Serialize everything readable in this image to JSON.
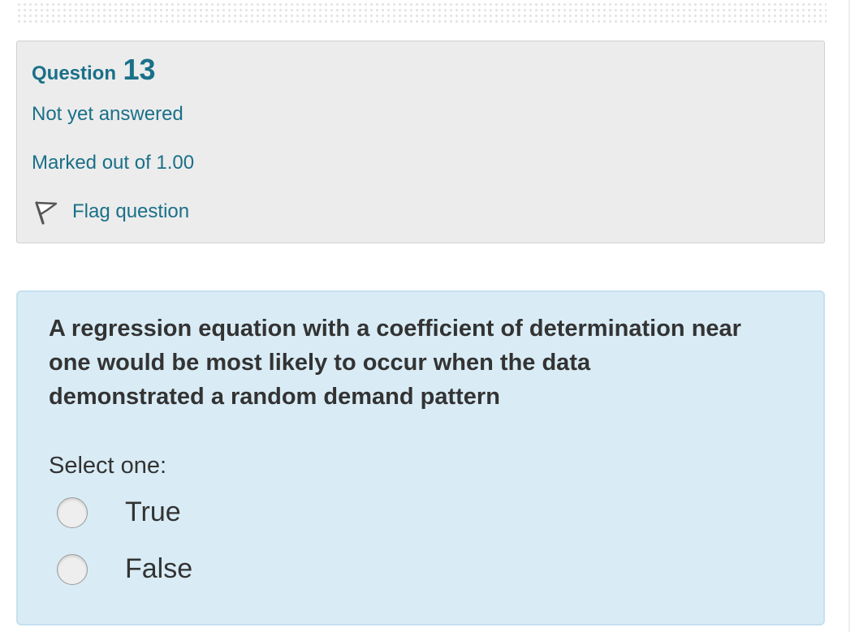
{
  "question_info": {
    "label_prefix": "Question",
    "number": "13",
    "state": "Not yet answered",
    "grade": "Marked out of 1.00",
    "flag_label": "Flag question",
    "flag_icon": "flag-icon"
  },
  "question": {
    "text": "A regression equation with a coefficient of determination near one would be most likely to occur when the data demonstrated a random demand pattern",
    "prompt": "Select one:",
    "answers": [
      {
        "label": "True",
        "selected": false
      },
      {
        "label": "False",
        "selected": false
      }
    ]
  },
  "colors": {
    "accent_text": "#1a7088",
    "info_background": "#ececec",
    "content_background": "#d9ecf6",
    "body_text": "#333333"
  }
}
